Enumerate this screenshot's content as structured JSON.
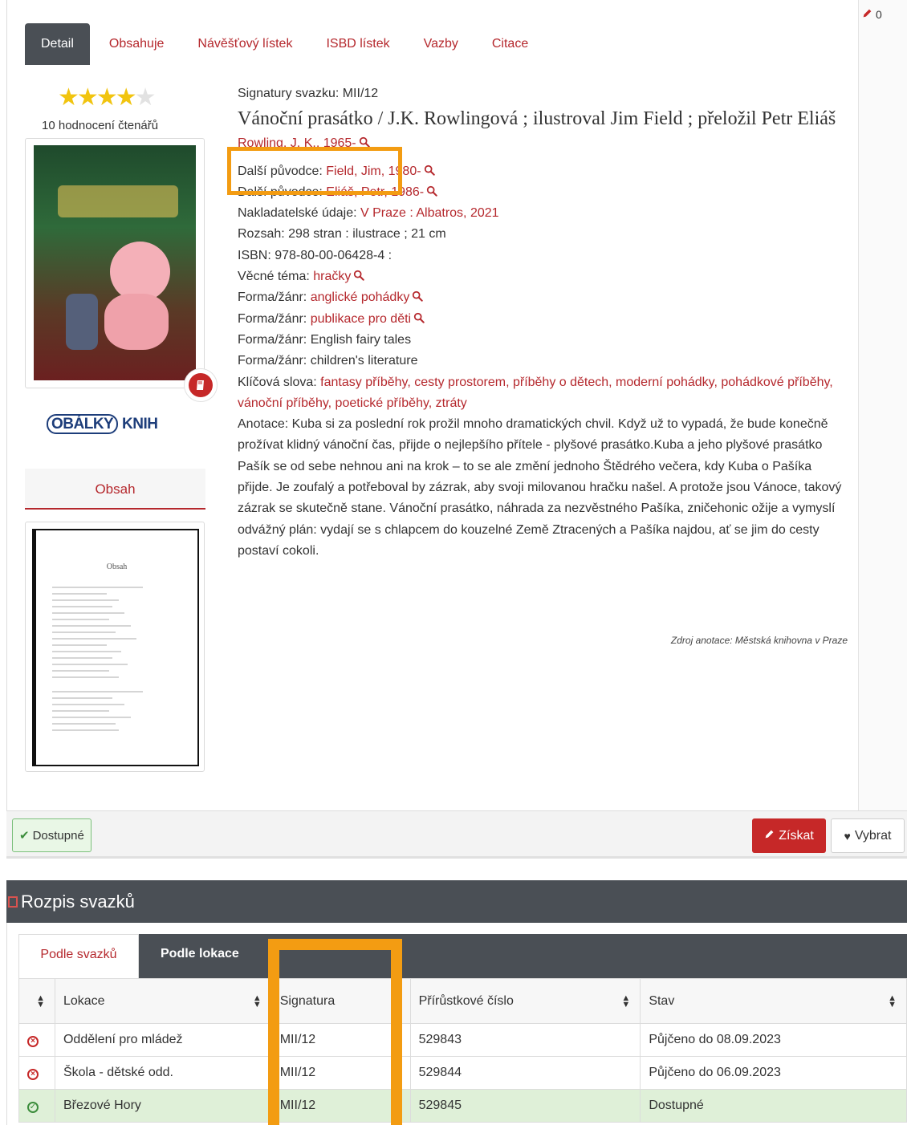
{
  "toolbar": {
    "edit_count": "0"
  },
  "tabs": [
    {
      "label": "Detail",
      "active": true
    },
    {
      "label": "Obsahuje"
    },
    {
      "label": "Návěšťový lístek"
    },
    {
      "label": "ISBD lístek"
    },
    {
      "label": "Vazby"
    },
    {
      "label": "Citace"
    }
  ],
  "rating": {
    "stars": 4,
    "max": 5,
    "count_label": "10 hodnocení čtenářů"
  },
  "obalky": {
    "part1": "OBÁLKY",
    "part2": "KNIH"
  },
  "obsah_tab": "Obsah",
  "toc": {
    "title": "Obsah"
  },
  "record": {
    "signature": "Signatury svazku: MII/12",
    "title": "Vánoční prasátko / J.K. Rowlingová ; ilustroval Jim Field ; přeložil Petr Eliáš",
    "author": "Rowling, J. K., 1965-",
    "contributors": [
      {
        "label": "Další původce: ",
        "value": "Field, Jim, 1980-"
      },
      {
        "label": "Další původce: ",
        "value": "Eliáš, Petr, 1986-"
      }
    ],
    "publisher": {
      "label": "Nakladatelské údaje: ",
      "value": "V Praze : Albatros, 2021"
    },
    "extent": "Rozsah: 298 stran : ilustrace ; 21 cm",
    "isbn": "ISBN: 978-80-00-06428-4 :",
    "subject": {
      "label": "Věcné téma: ",
      "value": "hračky"
    },
    "genres_linked": [
      {
        "label": "Forma/žánr: ",
        "value": "anglické pohádky"
      },
      {
        "label": "Forma/žánr: ",
        "value": "publikace pro děti"
      }
    ],
    "genres_plain": [
      "Forma/žánr: English fairy tales",
      "Forma/žánr: children's literature"
    ],
    "keywords": {
      "label": "Klíčová slova: ",
      "value": "fantasy příběhy, cesty prostorem, příběhy o dětech, moderní pohádky, pohádkové příběhy, vánoční příběhy, poetické příběhy, ztráty"
    },
    "annotation": "Anotace: Kuba si za poslední rok prožil mnoho dramatických chvil. Když už to vypadá, že bude konečně prožívat klidný vánoční čas, přijde o nejlepšího přítele - plyšové prasátko.Kuba a jeho plyšové prasátko Pašík se od sebe nehnou ani na krok – to se ale změní jednoho Štědrého večera, kdy Kuba o Pašíka přijde. Je zoufalý a potřeboval by zázrak, aby svoji milovanou hračku našel. A protože jsou Vánoce, takový zázrak se skutečně stane. Vánoční prasátko, náhrada za nezvěstného Pašíka, zničehonic ožije a vymyslí odvážný plán: vydají se s chlapcem do kouzelné Země Ztracených a Pašíka najdou, ať se jim do cesty postaví cokoli.",
    "annotation_source": "Zdroj anotace: Městská knihovna v Praze"
  },
  "actions": {
    "available": "Dostupné",
    "get": "Získat",
    "select": "Vybrat"
  },
  "volumes": {
    "title": "Rozpis svazků",
    "tabs": [
      "Podle svazků",
      "Podle lokace"
    ],
    "columns": [
      "Lokace",
      "Signatura",
      "Přírůstkové číslo",
      "Stav"
    ],
    "rows": [
      {
        "status": "bad",
        "location": "Oddělení pro mládež",
        "signature": "MII/12",
        "accession": "529843",
        "state": "Půjčeno do 08.09.2023"
      },
      {
        "status": "bad",
        "location": "Škola - dětské odd.",
        "signature": "MII/12",
        "accession": "529844",
        "state": "Půjčeno do 06.09.2023"
      },
      {
        "status": "ok",
        "location": "Březové Hory",
        "signature": "MII/12",
        "accession": "529845",
        "state": "Dostupné"
      }
    ]
  },
  "colors": {
    "accent": "#b5282d",
    "dark": "#4a4f55",
    "highlight": "#f39c12",
    "available_bg": "#dff0d8"
  }
}
